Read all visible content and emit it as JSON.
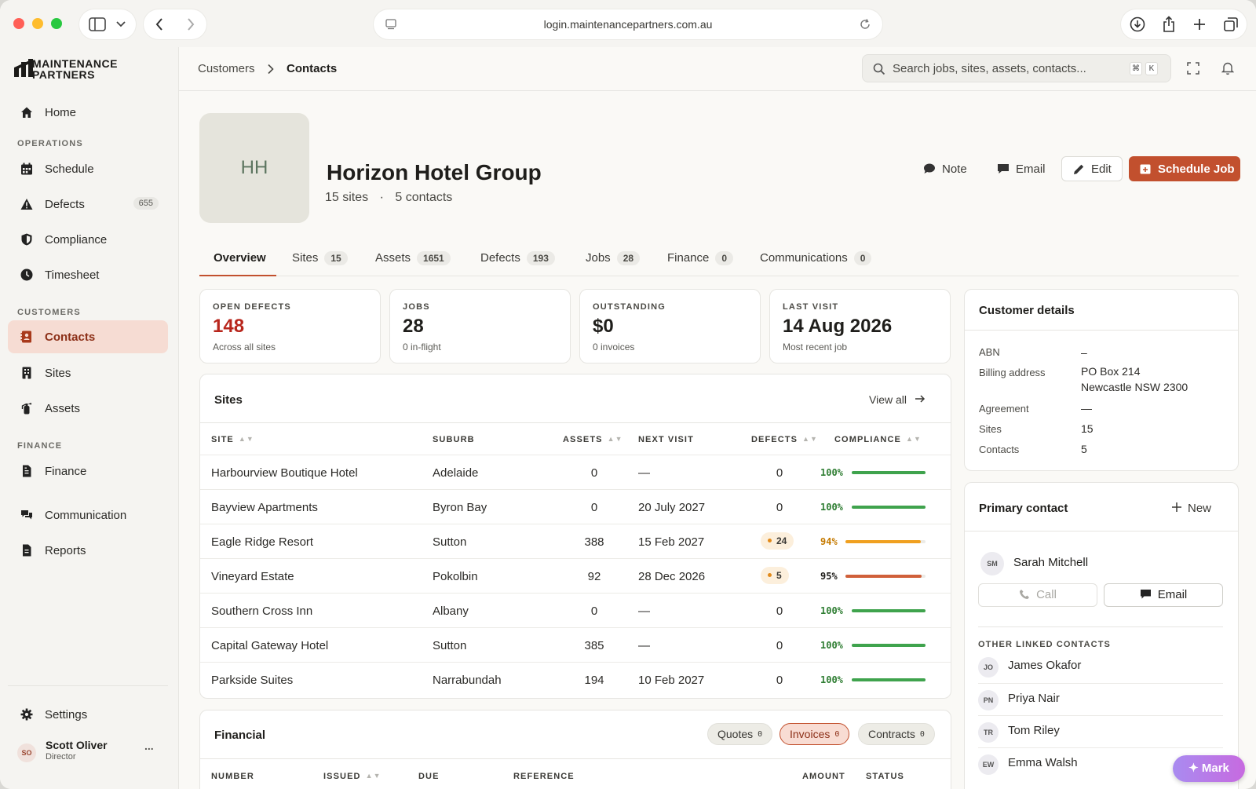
{
  "browser": {
    "url": "login.maintenancepartners.com.au"
  },
  "brand": {
    "line1": "MAINTENANCE",
    "line2": "PARTNERS",
    "accent": "#c2502e"
  },
  "sidebar": {
    "home": "Home",
    "operations_section": "OPERATIONS",
    "schedule": "Schedule",
    "defects": "Defects",
    "defects_count": "655",
    "compliance": "Compliance",
    "timesheet": "Timesheet",
    "customers_section": "CUSTOMERS",
    "contacts": "Contacts",
    "sites": "Sites",
    "assets": "Assets",
    "finance_section": "FINANCE",
    "finance": "Finance",
    "communication": "Communication",
    "reports": "Reports",
    "settings": "Settings",
    "user_initials": "SO",
    "user_name": "Scott Oliver",
    "user_role": "Director",
    "user_more": "..."
  },
  "topbar": {
    "crumb_parent": "Customers",
    "crumb_current": "Contacts",
    "search_placeholder": "Search jobs, sites, assets, contacts...",
    "kbd_cmd": "⌘",
    "kbd_k": "K"
  },
  "header": {
    "initials": "HH",
    "company": "Horizon Hotel Group",
    "sites_count": "15 sites",
    "separator": "·",
    "contacts_count": "5 contacts",
    "note": "Note",
    "email": "Email",
    "edit": "Edit",
    "schedule_job": "Schedule Job"
  },
  "tabs": [
    {
      "label": "Overview",
      "count": ""
    },
    {
      "label": "Sites",
      "count": "15"
    },
    {
      "label": "Assets",
      "count": "1651"
    },
    {
      "label": "Defects",
      "count": "193"
    },
    {
      "label": "Jobs",
      "count": "28"
    },
    {
      "label": "Finance",
      "count": "0"
    },
    {
      "label": "Communications",
      "count": "0"
    }
  ],
  "stats": [
    {
      "label": "OPEN DEFECTS",
      "value": "148",
      "sub": "Across all sites"
    },
    {
      "label": "JOBS",
      "value": "28",
      "sub": "0 in-flight"
    },
    {
      "label": "OUTSTANDING",
      "value": "$0",
      "sub": "0 invoices"
    },
    {
      "label": "LAST VISIT",
      "value": "14 Aug 2026",
      "sub": "Most recent job"
    }
  ],
  "sites_table": {
    "title": "Sites",
    "view_all": "View all",
    "headers": {
      "site": "SITE",
      "suburb": "SUBURB",
      "assets": "ASSETS",
      "next_visit": "NEXT VISIT",
      "defects": "DEFECTS",
      "compliance": "COMPLIANCE"
    },
    "rows": [
      {
        "site": "Harbourview Boutique Hotel",
        "suburb": "Adelaide",
        "assets": "0",
        "next_visit": "—",
        "defects": "0",
        "compliance": "100%",
        "compliance_value": 100,
        "bar_color": "#3fa34d"
      },
      {
        "site": "Bayview Apartments",
        "suburb": "Byron Bay",
        "assets": "0",
        "next_visit": "20 July 2027",
        "defects": "0",
        "compliance": "100%",
        "compliance_value": 100,
        "bar_color": "#3fa34d"
      },
      {
        "site": "Eagle Ridge Resort",
        "suburb": "Sutton",
        "assets": "388",
        "next_visit": "15 Feb 2027",
        "defects": "24",
        "compliance": "94%",
        "compliance_value": 94,
        "bar_color": "#f0a020"
      },
      {
        "site": "Vineyard Estate",
        "suburb": "Pokolbin",
        "assets": "92",
        "next_visit": "28 Dec 2026",
        "defects": "5",
        "compliance": "95%",
        "compliance_value": 95,
        "bar_color": "#d0603a"
      },
      {
        "site": "Southern Cross Inn",
        "suburb": "Albany",
        "assets": "0",
        "next_visit": "—",
        "defects": "0",
        "compliance": "100%",
        "compliance_value": 100,
        "bar_color": "#3fa34d"
      },
      {
        "site": "Capital Gateway Hotel",
        "suburb": "Sutton",
        "assets": "385",
        "next_visit": "—",
        "defects": "0",
        "compliance": "100%",
        "compliance_value": 100,
        "bar_color": "#3fa34d"
      },
      {
        "site": "Parkside Suites",
        "suburb": "Narrabundah",
        "assets": "194",
        "next_visit": "10 Feb 2027",
        "defects": "0",
        "compliance": "100%",
        "compliance_value": 100,
        "bar_color": "#3fa34d"
      }
    ]
  },
  "financial": {
    "title": "Financial",
    "chips": [
      {
        "label": "Quotes",
        "count": "0"
      },
      {
        "label": "Invoices",
        "count": "0"
      },
      {
        "label": "Contracts",
        "count": "0"
      }
    ],
    "headers": {
      "number": "NUMBER",
      "issued": "ISSUED",
      "due": "DUE",
      "reference": "REFERENCE",
      "amount": "AMOUNT",
      "status": "STATUS"
    }
  },
  "customer_details": {
    "title": "Customer details",
    "abn_label": "ABN",
    "abn_value": "–",
    "billing_label": "Billing address",
    "billing_line1": "PO Box 214",
    "billing_line2": "Newcastle NSW 2300",
    "agreement_label": "Agreement",
    "agreement_value": "—",
    "sites_label": "Sites",
    "sites_value": "15",
    "contacts_label": "Contacts",
    "contacts_value": "5"
  },
  "primary_contact": {
    "title": "Primary contact",
    "new": "New",
    "initials": "SM",
    "name": "Sarah Mitchell",
    "call": "Call",
    "email": "Email",
    "other_title": "OTHER LINKED CONTACTS",
    "others": [
      {
        "initials": "JO",
        "name": "James Okafor"
      },
      {
        "initials": "PN",
        "name": "Priya Nair"
      },
      {
        "initials": "TR",
        "name": "Tom Riley"
      },
      {
        "initials": "EW",
        "name": "Emma Walsh"
      }
    ]
  },
  "mark_button": "Mark"
}
